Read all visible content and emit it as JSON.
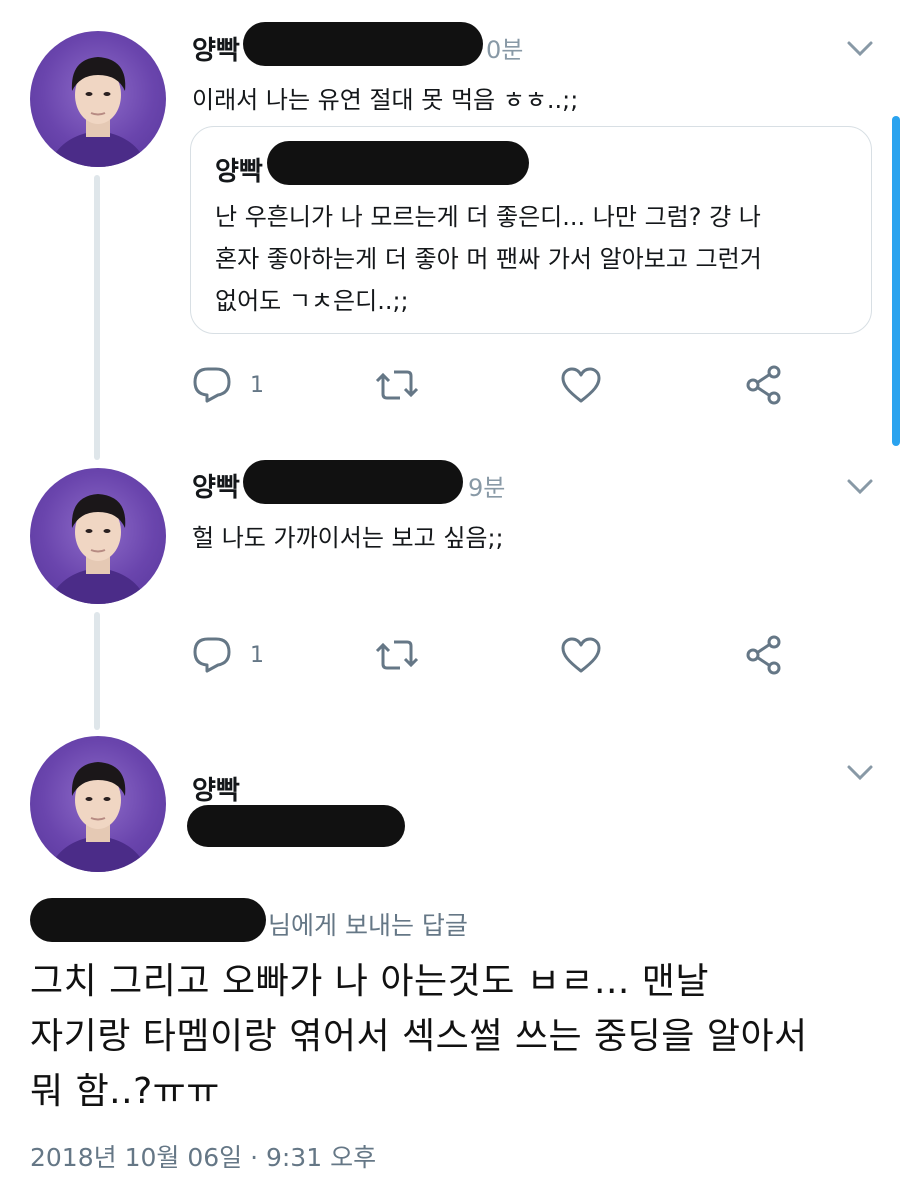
{
  "tweets": [
    {
      "name": "양빡",
      "time": "0분",
      "text": "이래서 나는 유연 절대 못 먹음 ㅎㅎ..;;",
      "quote": {
        "name": "양빡",
        "text_lines": [
          "난 우흔니가 나 모르는게 더 좋은디... 나만 그럼? 걍 나",
          "혼자 좋아하는게 더 좋아 머 팬싸 가서 알아보고 그런거",
          "없어도 ㄱㅊ은디..;;"
        ]
      },
      "reply_count": "1"
    },
    {
      "name": "양빡",
      "time": "9분",
      "text": "헐 나도 가까이서는 보고 싶음;;",
      "reply_count": "1"
    }
  ],
  "main_tweet": {
    "name": "양빡",
    "reply_to_suffix": "님에게 보내는 답글",
    "text_lines": [
      "그치 그리고 오빠가 나 아는것도 ㅂㄹ... 맨날",
      "자기랑 타멤이랑 엮어서 섹스썰 쓰는 중딩을 알아서",
      "뭐 함..?ㅠㅠ"
    ],
    "timestamp": "2018년 10월 06일 · 9:31 오후"
  },
  "icons": {
    "reply": "reply-icon",
    "retweet": "retweet-icon",
    "like": "heart-icon",
    "share": "share-icon",
    "caret": "chevron-down-icon"
  },
  "colors": {
    "avatar_bg": "#6a45ad",
    "icon_gray": "#657786",
    "scrollbar": "#2aa3ef"
  }
}
